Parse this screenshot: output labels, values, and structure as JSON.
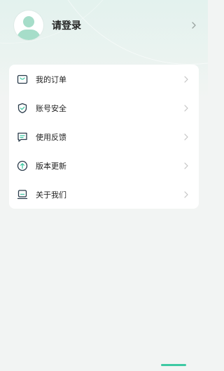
{
  "profile": {
    "login_label": "请登录"
  },
  "menu": {
    "items": [
      {
        "label": "我的订单",
        "icon": "order-bag-icon"
      },
      {
        "label": "账号安全",
        "icon": "shield-check-icon"
      },
      {
        "label": "使用反馈",
        "icon": "feedback-message-icon"
      },
      {
        "label": "版本更新",
        "icon": "upgrade-arrow-icon"
      },
      {
        "label": "关于我们",
        "icon": "about-us-icon"
      }
    ]
  },
  "bottom_nav": {
    "active_index": 2,
    "tabs": [
      {
        "icon": "home-icon"
      },
      {
        "icon": "document-icon"
      },
      {
        "icon": "profile-icon"
      }
    ]
  },
  "colors": {
    "accent": "#3ec9a3",
    "avatar": "#a6ddc9",
    "icon_stroke": "#2a3b4a",
    "chevron": "#c4c4c4"
  }
}
